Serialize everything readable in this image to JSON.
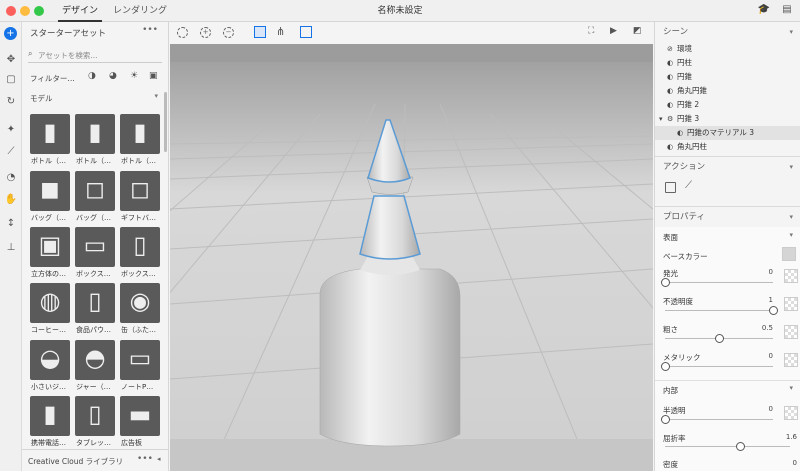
{
  "window": {
    "title": "名称未設定"
  },
  "tabs": [
    {
      "label": "デザイン"
    },
    {
      "label": "レンダリング"
    }
  ],
  "assets": {
    "title": "スターターアセット",
    "search_placeholder": "アセットを検索...",
    "filter_label": "フィルター…",
    "section": "モデル",
    "items": [
      {
        "label": "ボトル（…"
      },
      {
        "label": "ボトル（…"
      },
      {
        "label": "ボトル（…"
      },
      {
        "label": "バッグ（…"
      },
      {
        "label": "バッグ（…"
      },
      {
        "label": "ギフトバ…"
      },
      {
        "label": "立方体の…"
      },
      {
        "label": "ボックス…"
      },
      {
        "label": "ボックス…"
      },
      {
        "label": "コーヒー…"
      },
      {
        "label": "食品パウ…"
      },
      {
        "label": "缶（ふた…"
      },
      {
        "label": "小さいジ…"
      },
      {
        "label": "ジャー（…"
      },
      {
        "label": "ノートP…"
      },
      {
        "label": "携帯電話…"
      },
      {
        "label": "タブレッ…"
      },
      {
        "label": "広告板"
      }
    ],
    "footer": "Creative Cloud ライブラリ"
  },
  "scene": {
    "title": "シーン",
    "items": [
      {
        "label": "環境"
      },
      {
        "label": "円柱"
      },
      {
        "label": "円錐"
      },
      {
        "label": "角丸円錐"
      },
      {
        "label": "円錐 2"
      },
      {
        "label": "円錐 3"
      },
      {
        "label": "円錐のマテリアル 3"
      },
      {
        "label": "角丸円柱"
      }
    ]
  },
  "actions": {
    "title": "アクション"
  },
  "properties": {
    "title": "プロパティ",
    "surface": "表面",
    "base_color": "ベースカラー",
    "emission": {
      "label": "発光",
      "value": "0",
      "level": 0
    },
    "opacity": {
      "label": "不透明度",
      "value": "1",
      "level": 1
    },
    "roughness": {
      "label": "粗さ",
      "value": "0.5",
      "level": 0.5
    },
    "metallic": {
      "label": "メタリック",
      "value": "0",
      "level": 0
    },
    "interior": "内部",
    "translucence": {
      "label": "半透明",
      "value": "0",
      "level": 0
    },
    "refraction": {
      "label": "屈折率",
      "value": "1.6",
      "level": 0.6
    },
    "density": {
      "label": "密度",
      "value": "0"
    }
  },
  "colors": {
    "accent": "#4a90d9",
    "selection_outline": "#5b9bd5"
  }
}
